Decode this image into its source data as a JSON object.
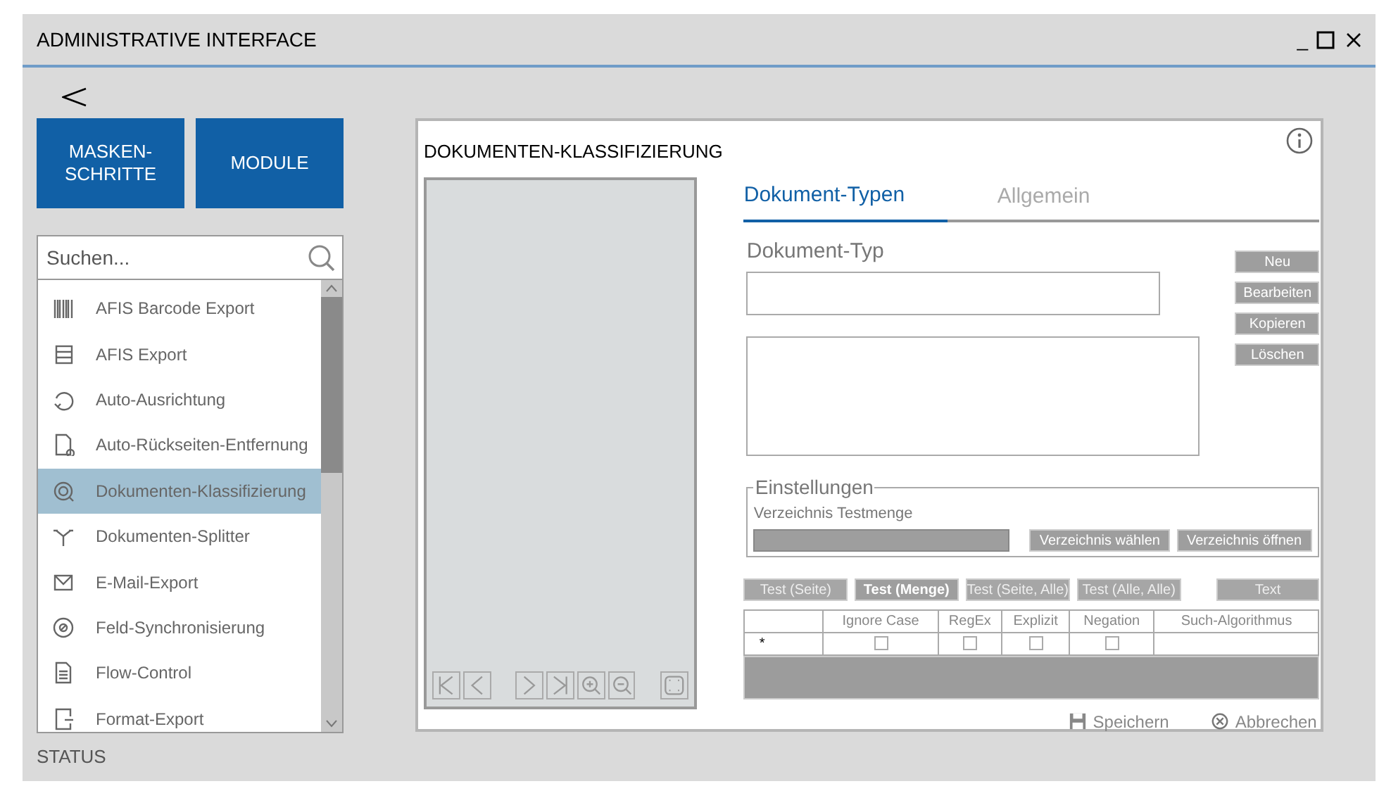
{
  "window": {
    "title": "ADMINISTRATIVE INTERFACE",
    "controls": [
      "_"
    ]
  },
  "nav_buttons": [
    "MASKEN-\nSCHRITTE",
    "MODULE"
  ],
  "search": {
    "placeholder": "Suchen..."
  },
  "modules": [
    {
      "label": "AFIS Barcode Export",
      "selected": false
    },
    {
      "label": "AFIS Export",
      "selected": false
    },
    {
      "label": "Auto-Ausrichtung",
      "selected": false
    },
    {
      "label": "Auto-Rückseiten-Entfernung",
      "selected": false
    },
    {
      "label": "Dokumenten-Klassifizierung",
      "selected": true
    },
    {
      "label": "Dokumenten-Splitter",
      "selected": false
    },
    {
      "label": "E-Mail-Export",
      "selected": false
    },
    {
      "label": "Feld-Synchronisierung",
      "selected": false
    },
    {
      "label": "Flow-Control",
      "selected": false
    },
    {
      "label": "Format-Export",
      "selected": false
    }
  ],
  "panel": {
    "title": "DOKUMENTEN-KLASSIFIZIERUNG",
    "tabs": [
      {
        "label": "Dokument-Typen",
        "selected": true
      },
      {
        "label": "Allgemein",
        "selected": false
      }
    ],
    "dokument_typ": {
      "label": "Dokument-Typ"
    },
    "side_buttons": [
      "Neu",
      "Bearbeiten",
      "Kopieren",
      "Löschen"
    ],
    "settings": {
      "legend": "Einstellungen",
      "label": "Verzeichnis Testmenge",
      "buttons": [
        "Verzeichnis wählen",
        "Verzeichnis öffnen"
      ]
    },
    "test_buttons": [
      {
        "label": "Test (Seite)",
        "selected": false
      },
      {
        "label": "Test (Menge)",
        "selected": true
      },
      {
        "label": "Test (Seite, Alle)",
        "selected": false
      },
      {
        "label": "Test (Alle, Alle)",
        "selected": false
      },
      {
        "label": "Text",
        "selected": false
      }
    ],
    "table": {
      "columns": [
        "Ignore Case",
        "RegEx",
        "Explizit",
        "Negation",
        "Such-Algorithmus"
      ],
      "rows": [
        {
          "marker": "*",
          "ignore_case": false,
          "regex": false,
          "explizit": false,
          "negation": false
        }
      ]
    },
    "footer": [
      "Speichern",
      "Abbrechen"
    ]
  },
  "status_bar": "STATUS"
}
